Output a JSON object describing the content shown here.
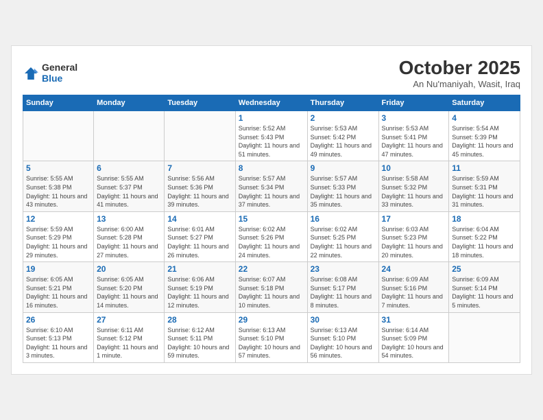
{
  "header": {
    "logo_general": "General",
    "logo_blue": "Blue",
    "month_title": "October 2025",
    "location": "An Nu'maniyah, Wasit, Iraq"
  },
  "weekdays": [
    "Sunday",
    "Monday",
    "Tuesday",
    "Wednesday",
    "Thursday",
    "Friday",
    "Saturday"
  ],
  "weeks": [
    [
      null,
      null,
      null,
      {
        "day": "1",
        "sunrise": "Sunrise: 5:52 AM",
        "sunset": "Sunset: 5:43 PM",
        "daylight": "Daylight: 11 hours and 51 minutes."
      },
      {
        "day": "2",
        "sunrise": "Sunrise: 5:53 AM",
        "sunset": "Sunset: 5:42 PM",
        "daylight": "Daylight: 11 hours and 49 minutes."
      },
      {
        "day": "3",
        "sunrise": "Sunrise: 5:53 AM",
        "sunset": "Sunset: 5:41 PM",
        "daylight": "Daylight: 11 hours and 47 minutes."
      },
      {
        "day": "4",
        "sunrise": "Sunrise: 5:54 AM",
        "sunset": "Sunset: 5:39 PM",
        "daylight": "Daylight: 11 hours and 45 minutes."
      }
    ],
    [
      {
        "day": "5",
        "sunrise": "Sunrise: 5:55 AM",
        "sunset": "Sunset: 5:38 PM",
        "daylight": "Daylight: 11 hours and 43 minutes."
      },
      {
        "day": "6",
        "sunrise": "Sunrise: 5:55 AM",
        "sunset": "Sunset: 5:37 PM",
        "daylight": "Daylight: 11 hours and 41 minutes."
      },
      {
        "day": "7",
        "sunrise": "Sunrise: 5:56 AM",
        "sunset": "Sunset: 5:36 PM",
        "daylight": "Daylight: 11 hours and 39 minutes."
      },
      {
        "day": "8",
        "sunrise": "Sunrise: 5:57 AM",
        "sunset": "Sunset: 5:34 PM",
        "daylight": "Daylight: 11 hours and 37 minutes."
      },
      {
        "day": "9",
        "sunrise": "Sunrise: 5:57 AM",
        "sunset": "Sunset: 5:33 PM",
        "daylight": "Daylight: 11 hours and 35 minutes."
      },
      {
        "day": "10",
        "sunrise": "Sunrise: 5:58 AM",
        "sunset": "Sunset: 5:32 PM",
        "daylight": "Daylight: 11 hours and 33 minutes."
      },
      {
        "day": "11",
        "sunrise": "Sunrise: 5:59 AM",
        "sunset": "Sunset: 5:31 PM",
        "daylight": "Daylight: 11 hours and 31 minutes."
      }
    ],
    [
      {
        "day": "12",
        "sunrise": "Sunrise: 5:59 AM",
        "sunset": "Sunset: 5:29 PM",
        "daylight": "Daylight: 11 hours and 29 minutes."
      },
      {
        "day": "13",
        "sunrise": "Sunrise: 6:00 AM",
        "sunset": "Sunset: 5:28 PM",
        "daylight": "Daylight: 11 hours and 27 minutes."
      },
      {
        "day": "14",
        "sunrise": "Sunrise: 6:01 AM",
        "sunset": "Sunset: 5:27 PM",
        "daylight": "Daylight: 11 hours and 26 minutes."
      },
      {
        "day": "15",
        "sunrise": "Sunrise: 6:02 AM",
        "sunset": "Sunset: 5:26 PM",
        "daylight": "Daylight: 11 hours and 24 minutes."
      },
      {
        "day": "16",
        "sunrise": "Sunrise: 6:02 AM",
        "sunset": "Sunset: 5:25 PM",
        "daylight": "Daylight: 11 hours and 22 minutes."
      },
      {
        "day": "17",
        "sunrise": "Sunrise: 6:03 AM",
        "sunset": "Sunset: 5:23 PM",
        "daylight": "Daylight: 11 hours and 20 minutes."
      },
      {
        "day": "18",
        "sunrise": "Sunrise: 6:04 AM",
        "sunset": "Sunset: 5:22 PM",
        "daylight": "Daylight: 11 hours and 18 minutes."
      }
    ],
    [
      {
        "day": "19",
        "sunrise": "Sunrise: 6:05 AM",
        "sunset": "Sunset: 5:21 PM",
        "daylight": "Daylight: 11 hours and 16 minutes."
      },
      {
        "day": "20",
        "sunrise": "Sunrise: 6:05 AM",
        "sunset": "Sunset: 5:20 PM",
        "daylight": "Daylight: 11 hours and 14 minutes."
      },
      {
        "day": "21",
        "sunrise": "Sunrise: 6:06 AM",
        "sunset": "Sunset: 5:19 PM",
        "daylight": "Daylight: 11 hours and 12 minutes."
      },
      {
        "day": "22",
        "sunrise": "Sunrise: 6:07 AM",
        "sunset": "Sunset: 5:18 PM",
        "daylight": "Daylight: 11 hours and 10 minutes."
      },
      {
        "day": "23",
        "sunrise": "Sunrise: 6:08 AM",
        "sunset": "Sunset: 5:17 PM",
        "daylight": "Daylight: 11 hours and 8 minutes."
      },
      {
        "day": "24",
        "sunrise": "Sunrise: 6:09 AM",
        "sunset": "Sunset: 5:16 PM",
        "daylight": "Daylight: 11 hours and 7 minutes."
      },
      {
        "day": "25",
        "sunrise": "Sunrise: 6:09 AM",
        "sunset": "Sunset: 5:14 PM",
        "daylight": "Daylight: 11 hours and 5 minutes."
      }
    ],
    [
      {
        "day": "26",
        "sunrise": "Sunrise: 6:10 AM",
        "sunset": "Sunset: 5:13 PM",
        "daylight": "Daylight: 11 hours and 3 minutes."
      },
      {
        "day": "27",
        "sunrise": "Sunrise: 6:11 AM",
        "sunset": "Sunset: 5:12 PM",
        "daylight": "Daylight: 11 hours and 1 minute."
      },
      {
        "day": "28",
        "sunrise": "Sunrise: 6:12 AM",
        "sunset": "Sunset: 5:11 PM",
        "daylight": "Daylight: 10 hours and 59 minutes."
      },
      {
        "day": "29",
        "sunrise": "Sunrise: 6:13 AM",
        "sunset": "Sunset: 5:10 PM",
        "daylight": "Daylight: 10 hours and 57 minutes."
      },
      {
        "day": "30",
        "sunrise": "Sunrise: 6:13 AM",
        "sunset": "Sunset: 5:10 PM",
        "daylight": "Daylight: 10 hours and 56 minutes."
      },
      {
        "day": "31",
        "sunrise": "Sunrise: 6:14 AM",
        "sunset": "Sunset: 5:09 PM",
        "daylight": "Daylight: 10 hours and 54 minutes."
      },
      null
    ]
  ]
}
